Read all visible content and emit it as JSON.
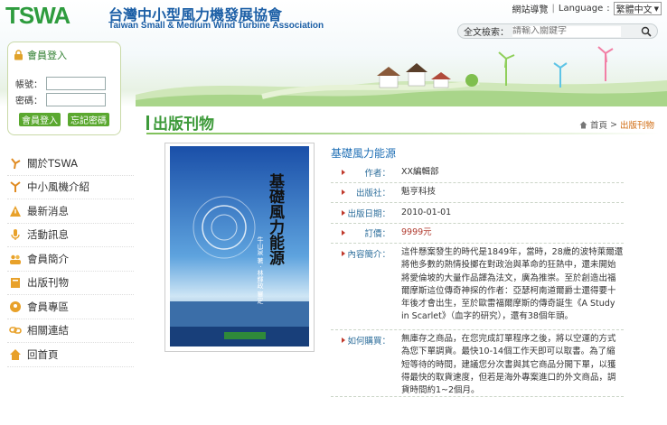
{
  "header": {
    "logo_mark": "TSWA",
    "logo_zh": "台灣中小型風力機發展協會",
    "logo_en": "Taiwan Small & Medium Wind Turbine Association",
    "sitemap_label": "網站導覽",
    "language_label": "Language",
    "language_selected": "繁體中文",
    "search_label": "全文檢索：",
    "search_placeholder": "請輸入關鍵字"
  },
  "login": {
    "title": "會員登入",
    "account_label": "帳號：",
    "password_label": "密碼：",
    "login_button": "會員登入",
    "forgot_button": "忘記密碼"
  },
  "nav": {
    "items": [
      {
        "label": "關於TSWA",
        "icon": "windmill-icon"
      },
      {
        "label": "中小風機介紹",
        "icon": "turbine-icon"
      },
      {
        "label": "最新消息",
        "icon": "alert-icon"
      },
      {
        "label": "活動訊息",
        "icon": "microphone-icon"
      },
      {
        "label": "會員簡介",
        "icon": "users-icon"
      },
      {
        "label": "出版刊物",
        "icon": "book-icon"
      },
      {
        "label": "會員專區",
        "icon": "member-icon"
      },
      {
        "label": "相關連結",
        "icon": "link-icon"
      },
      {
        "label": "回首頁",
        "icon": "home-icon"
      }
    ]
  },
  "main": {
    "title": "出版刊物",
    "breadcrumb": {
      "home": "首頁",
      "separator": ">",
      "current": "出版刊物"
    },
    "book": {
      "title": "基礎風力能源",
      "cover_title": "基礎風力能源",
      "cover_authors": "牛山泉 著 · 林輝政 審定",
      "rows": [
        {
          "label": "作者：",
          "value": "XX編輯部"
        },
        {
          "label": "出版社：",
          "value": "魁亨科技"
        },
        {
          "label": "出版日期：",
          "value": "2010-01-01"
        },
        {
          "label": "訂價：",
          "value": "9999元"
        },
        {
          "label": "內容簡介：",
          "value": "這件懸案發生的時代是1849年，當時，28歲的波特萊爾還將他多數的熱情投擲在對政治與革命的狂熱中，還未開始將愛倫坡的大量作品譯為法文，廣為推崇。至於創造出福爾摩斯這位傳奇神探的作者：亞瑟柯南道爾爵士還得要十年後才會出生，至於歐雷福爾摩斯的傳奇誕生《A Study in Scarlet》（血字的研究），還有38個年頭。"
        },
        {
          "label": "如何購買：",
          "value": "無庫存之商品，在您完成訂單程序之後，將以空運的方式為您下單調貨。最快10-14個工作天即可以取書。為了縮短等待的時間，建議您分次書與其它商品分開下單，以獲得最快的取貨速度，但若是海外專案進口的外文商品，調貨時間約1~2個月。"
        }
      ]
    }
  },
  "colors": {
    "brand_blue": "#1c5fa6",
    "brand_green": "#3d9a3a",
    "accent_orange": "#d06b10",
    "price_red": "#b03a2e"
  }
}
